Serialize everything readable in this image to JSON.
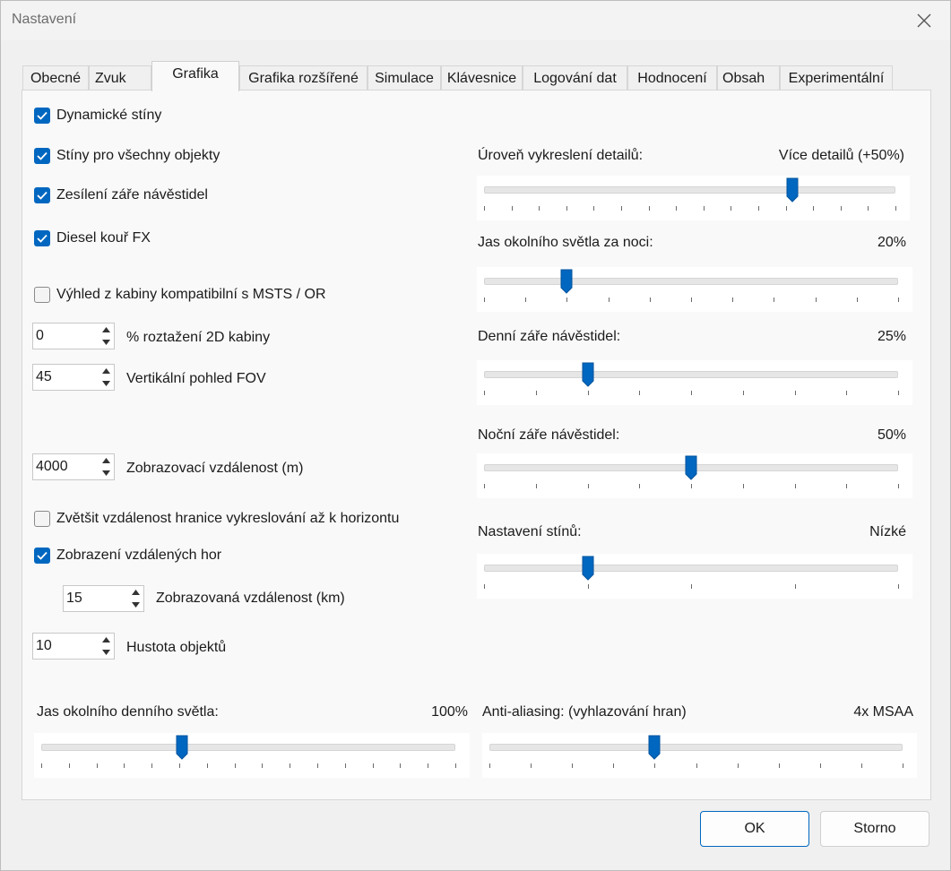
{
  "window": {
    "title": "Nastavení"
  },
  "tabs": [
    "Obecné",
    "Zvuk",
    "Grafika",
    "Grafika rozšířené",
    "Simulace",
    "Klávesnice",
    "Logování dat",
    "Hodnocení",
    "Obsah",
    "Experimentální"
  ],
  "active_tab": "Grafika",
  "checkboxes": {
    "dynamic_shadows": {
      "label": "Dynamické stíny",
      "checked": true
    },
    "shadows_all": {
      "label": "Stíny pro všechny objekty",
      "checked": true
    },
    "signal_glow": {
      "label": "Zesílení záře návěstidel",
      "checked": true
    },
    "diesel_smoke": {
      "label": "Diesel kouř FX",
      "checked": true
    },
    "cab_view_msts": {
      "label": "Výhled z kabiny kompatibilní s MSTS / OR",
      "checked": false
    },
    "extend_horizon": {
      "label": "Zvětšit vzdálenost hranice vykreslování až k horizontu",
      "checked": false
    },
    "distant_mountains": {
      "label": "Zobrazení vzdálených hor",
      "checked": true
    }
  },
  "spinners": {
    "cab_stretch": {
      "value": "0",
      "label": "% roztažení 2D kabiny"
    },
    "fov": {
      "value": "45",
      "label": "Vertikální pohled FOV"
    },
    "view_distance": {
      "value": "4000",
      "label": "Zobrazovací vzdálenost (m)"
    },
    "mountain_distance": {
      "value": "15",
      "label": "Zobrazovaná vzdálenost (km)"
    },
    "object_density": {
      "value": "10",
      "label": "Hustota objektů"
    }
  },
  "sliders": {
    "detail_level": {
      "label": "Úroveň vykreslení detailů:",
      "value_text": "Více detailů (+50%)",
      "position": 0.75,
      "ticks": 16
    },
    "night_ambient": {
      "label": "Jas okolního světla za noci:",
      "value_text": "20%",
      "position": 0.2,
      "ticks": 11
    },
    "day_signal_glow": {
      "label": "Denní záře návěstidel:",
      "value_text": "25%",
      "position": 0.25,
      "ticks": 9
    },
    "night_signal_glow": {
      "label": "Noční záře návěstidel:",
      "value_text": "50%",
      "position": 0.5,
      "ticks": 9
    },
    "shadow_quality": {
      "label": "Nastavení stínů:",
      "value_text": "Nízké",
      "position": 0.25,
      "ticks": 5
    },
    "day_ambient": {
      "label": "Jas okolního denního světla:",
      "value_text": "100%",
      "position": 0.34,
      "ticks": 16
    },
    "anti_aliasing": {
      "label": "Anti-aliasing: (vyhlazování hran)",
      "value_text": "4x MSAA",
      "position": 0.4,
      "ticks": 11
    }
  },
  "buttons": {
    "ok": "OK",
    "cancel": "Storno"
  },
  "colors": {
    "accent": "#0067c0"
  }
}
